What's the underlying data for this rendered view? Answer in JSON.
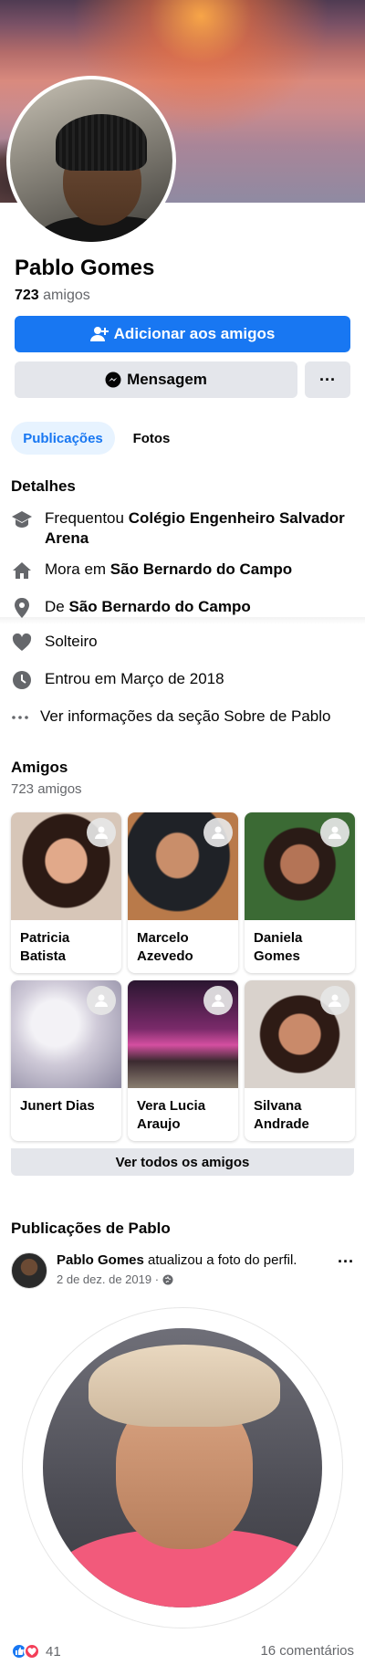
{
  "profile": {
    "name": "Pablo Gomes",
    "friends_count": "723",
    "friends_label": "amigos"
  },
  "actions": {
    "add_friend": "Adicionar aos amigos",
    "message": "Mensagem",
    "more": "···"
  },
  "tabs": {
    "posts": "Publicações",
    "photos": "Fotos"
  },
  "details": {
    "title": "Detalhes",
    "studied_prefix": "Frequentou ",
    "studied_value": "Colégio Engenheiro Salvador Arena",
    "lives_prefix": "Mora em ",
    "lives_value": "São Bernardo do Campo",
    "from_prefix": "De ",
    "from_value": "São Bernardo do Campo",
    "relationship": "Solteiro",
    "joined": "Entrou em Março de 2018",
    "see_about": "Ver informações da seção Sobre de Pablo"
  },
  "friends": {
    "title": "Amigos",
    "subtitle": "723 amigos",
    "list": [
      {
        "name": "Patricia Batista"
      },
      {
        "name": "Marcelo Azevedo"
      },
      {
        "name": "Daniela Gomes"
      },
      {
        "name": "Junert Dias"
      },
      {
        "name": "Vera Lucia Araujo"
      },
      {
        "name": "Silvana Andrade"
      }
    ],
    "see_all": "Ver todos os amigos"
  },
  "posts": {
    "title": "Publicações de Pablo",
    "author": "Pablo Gomes",
    "action": " atualizou a foto do perfil.",
    "date": "2 de dez. de 2019 · ",
    "reactions_count": "41",
    "comments": "16 comentários"
  },
  "colors": {
    "accent": "#1877f2",
    "secondary_btn": "#e4e6eb",
    "muted_text": "#65676b"
  }
}
